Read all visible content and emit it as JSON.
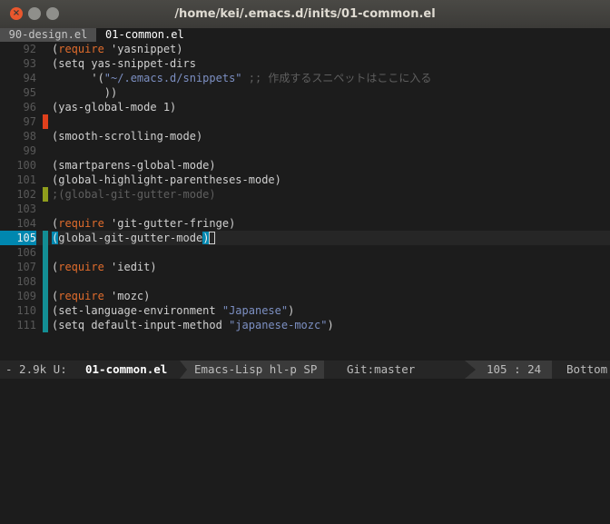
{
  "window": {
    "title": "/home/kei/.emacs.d/inits/01-common.el",
    "controls": [
      "close-icon",
      "minimize-icon",
      "maximize-icon"
    ]
  },
  "tabs": [
    {
      "label": "90-design.el",
      "active": false
    },
    {
      "label": "01-common.el",
      "active": true
    }
  ],
  "lines": [
    {
      "num": "92",
      "gutter": "none",
      "current": false,
      "segs": [
        {
          "t": "(",
          "c": "paren"
        },
        {
          "t": "require",
          "c": "kw"
        },
        {
          "t": " 'yasnippet",
          "c": "fn"
        },
        {
          "t": ")",
          "c": "paren"
        }
      ]
    },
    {
      "num": "93",
      "gutter": "none",
      "current": false,
      "segs": [
        {
          "t": "(setq yas-snippet-dirs",
          "c": "fn"
        }
      ]
    },
    {
      "num": "94",
      "gutter": "none",
      "current": false,
      "segs": [
        {
          "t": "      '(",
          "c": "fn"
        },
        {
          "t": "\"~/.emacs.d/snippets\"",
          "c": "str"
        },
        {
          "t": " ;; 作成するスニペットはここに入る",
          "c": "cmt"
        }
      ]
    },
    {
      "num": "95",
      "gutter": "none",
      "current": false,
      "segs": [
        {
          "t": "        ))",
          "c": "fn"
        }
      ]
    },
    {
      "num": "96",
      "gutter": "none",
      "current": false,
      "segs": [
        {
          "t": "(yas-global-mode 1)",
          "c": "fn"
        }
      ]
    },
    {
      "num": "97",
      "gutter": "removed",
      "current": false,
      "segs": []
    },
    {
      "num": "98",
      "gutter": "none",
      "current": false,
      "segs": [
        {
          "t": "(smooth-scrolling-mode)",
          "c": "fn"
        }
      ]
    },
    {
      "num": "99",
      "gutter": "none",
      "current": false,
      "segs": []
    },
    {
      "num": "100",
      "gutter": "none",
      "current": false,
      "segs": [
        {
          "t": "(smartparens-global-mode)",
          "c": "fn"
        }
      ]
    },
    {
      "num": "101",
      "gutter": "none",
      "current": false,
      "segs": [
        {
          "t": "(global-highlight-parentheses-mode)",
          "c": "fn"
        }
      ]
    },
    {
      "num": "102",
      "gutter": "modified",
      "current": false,
      "segs": [
        {
          "t": ";(global-git-gutter-mode)",
          "c": "cmt"
        }
      ]
    },
    {
      "num": "103",
      "gutter": "none",
      "current": false,
      "segs": []
    },
    {
      "num": "104",
      "gutter": "none",
      "current": false,
      "segs": [
        {
          "t": "(",
          "c": "paren"
        },
        {
          "t": "require",
          "c": "kw"
        },
        {
          "t": " 'git-gutter-fringe",
          "c": "fn"
        },
        {
          "t": ")",
          "c": "paren"
        }
      ]
    },
    {
      "num": "105",
      "gutter": "added",
      "current": true,
      "segs": [
        {
          "t": "(",
          "c": "cursor-paren"
        },
        {
          "t": "global-git-gutter-mode",
          "c": "fn"
        },
        {
          "t": ")",
          "c": "cursor-paren"
        }
      ]
    },
    {
      "num": "106",
      "gutter": "added",
      "current": false,
      "segs": []
    },
    {
      "num": "107",
      "gutter": "added",
      "current": false,
      "segs": [
        {
          "t": "(",
          "c": "paren"
        },
        {
          "t": "require",
          "c": "kw"
        },
        {
          "t": " 'iedit",
          "c": "fn"
        },
        {
          "t": ")",
          "c": "paren"
        }
      ]
    },
    {
      "num": "108",
      "gutter": "added",
      "current": false,
      "segs": []
    },
    {
      "num": "109",
      "gutter": "added",
      "current": false,
      "segs": [
        {
          "t": "(",
          "c": "paren"
        },
        {
          "t": "require",
          "c": "kw"
        },
        {
          "t": " 'mozc",
          "c": "fn"
        },
        {
          "t": ")",
          "c": "paren"
        }
      ]
    },
    {
      "num": "110",
      "gutter": "added",
      "current": false,
      "segs": [
        {
          "t": "(set-language-environment ",
          "c": "fn"
        },
        {
          "t": "\"Japanese\"",
          "c": "str"
        },
        {
          "t": ")",
          "c": "fn"
        }
      ]
    },
    {
      "num": "111",
      "gutter": "added",
      "current": false,
      "segs": [
        {
          "t": "(setq default-input-method ",
          "c": "fn"
        },
        {
          "t": "\"japanese-mozc\"",
          "c": "str"
        },
        {
          "t": ")",
          "c": "fn"
        }
      ]
    }
  ],
  "modeline": {
    "info": "- 2.9k U:",
    "buffer": "01-common.el",
    "mode": "Emacs-Lisp hl-p SP",
    "git": "Git:master",
    "position": "105 : 24",
    "percent": "Bottom"
  },
  "colors": {
    "keyword": "#e06c2c",
    "string": "#7c8fc2",
    "comment": "#5f5f5f",
    "gutter_added": "#138e94",
    "gutter_modified": "#8f9d1c",
    "gutter_removed": "#e0401c",
    "current_line_number": "#0087af"
  }
}
